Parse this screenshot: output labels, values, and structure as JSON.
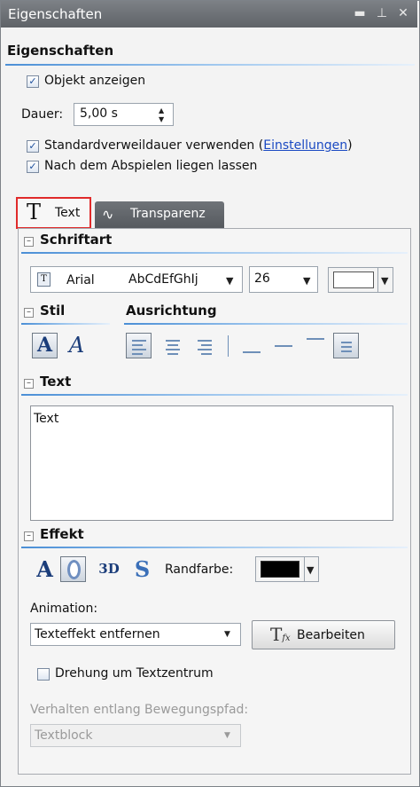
{
  "window": {
    "title": "Eigenschaften",
    "controls": [
      "minimize-icon",
      "pin-icon",
      "close-icon"
    ]
  },
  "section_title": "Eigenschaften",
  "show_object": {
    "label": "Objekt anzeigen",
    "checked": true
  },
  "duration": {
    "label": "Dauer:",
    "value": "5,00 s"
  },
  "use_default": {
    "label": "Standardverweildauer verwenden (",
    "link": "Einstellungen",
    "label_end": ")",
    "checked": true
  },
  "stay_after": {
    "label": "Nach dem Abspielen liegen lassen",
    "checked": true
  },
  "tabs": [
    {
      "icon": "T",
      "label": "Text",
      "active": true
    },
    {
      "label": "Transparenz",
      "active": false
    }
  ],
  "font_section": {
    "title": "Schriftart",
    "font_name": "Arial",
    "font_preview": "AbCdEfGhIj",
    "size": "26",
    "color": "#ffffff"
  },
  "style_section": {
    "title": "Stil"
  },
  "align_section": {
    "title": "Ausrichtung"
  },
  "text_section": {
    "title": "Text",
    "value": "Text"
  },
  "effect_section": {
    "title": "Effekt",
    "btn_3d": "3D",
    "border_color_label": "Randfarbe:",
    "border_color": "#000000",
    "animation_label": "Animation:",
    "animation_value": "Texteffekt entfernen",
    "edit_button": "Bearbeiten",
    "rotate": {
      "label": "Drehung um Textzentrum",
      "checked": false
    },
    "path_label": "Verhalten entlang Bewegungspfad:",
    "path_value": "Textblock"
  }
}
